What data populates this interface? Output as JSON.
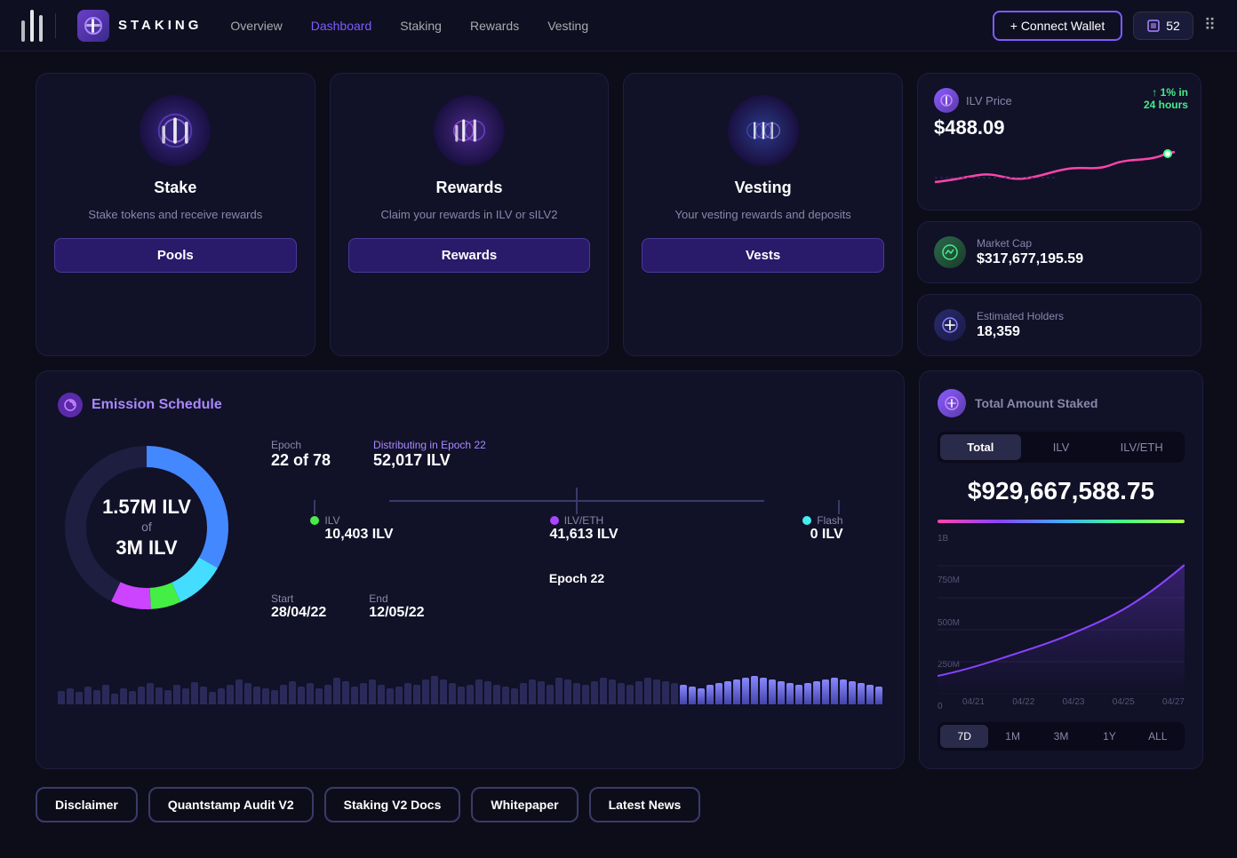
{
  "nav": {
    "logo_text": "STAKING",
    "links": [
      {
        "label": "Overview",
        "active": false
      },
      {
        "label": "Dashboard",
        "active": false
      },
      {
        "label": "Staking",
        "active": false
      },
      {
        "label": "Rewards",
        "active": false
      },
      {
        "label": "Vesting",
        "active": false
      }
    ],
    "connect_label": "+ Connect Wallet",
    "badge_value": "52"
  },
  "stake_card": {
    "title": "Stake",
    "description": "Stake tokens and receive rewards",
    "button_label": "Pools"
  },
  "rewards_card": {
    "title": "Rewards",
    "description": "Claim your rewards in ILV or sILV2",
    "button_label": "Rewards"
  },
  "vesting_card": {
    "title": "Vesting",
    "description": "Your vesting rewards and deposits",
    "button_label": "Vests"
  },
  "price_card": {
    "label": "ILV Price",
    "value": "$488.09",
    "change": "1% in",
    "change2": "24 hours",
    "change_positive": true
  },
  "market_cap": {
    "label": "Market Cap",
    "value": "$317,677,195.59"
  },
  "holders": {
    "label": "Estimated Holders",
    "value": "18,359"
  },
  "emission": {
    "title": "Emission Schedule",
    "donut_main": "1.57M ILV",
    "donut_of": "of",
    "donut_total": "3M ILV",
    "epoch_label": "Epoch",
    "epoch_value": "22 of 78",
    "distributing_label": "Distributing in Epoch 22",
    "distributing_value": "52,017 ILV",
    "ilv_label": "ILV",
    "ilv_value": "10,403 ILV",
    "ilveth_label": "ILV/ETH",
    "ilveth_value": "41,613 ILV",
    "flash_label": "Flash",
    "flash_value": "0 ILV",
    "epoch_num_label": "Epoch 22",
    "start_label": "Start",
    "start_value": "28/04/22",
    "end_label": "End",
    "end_value": "12/05/22"
  },
  "staking_total": {
    "title": "Total Amount Staked",
    "tabs": [
      "Total",
      "ILV",
      "ILV/ETH"
    ],
    "active_tab": "Total",
    "amount": "$929,667,588.75",
    "chart_labels_y": [
      "1B",
      "750M",
      "500M",
      "250M",
      "0"
    ],
    "chart_labels_x": [
      "04/21",
      "04/22",
      "04/23",
      "04/25",
      "04/27"
    ],
    "time_tabs": [
      "7D",
      "1M",
      "3M",
      "1Y",
      "ALL"
    ],
    "active_time": "7D"
  },
  "footer": {
    "links": [
      "Disclaimer",
      "Quantstamp Audit V2",
      "Staking V2 Docs",
      "Whitepaper",
      "Latest News"
    ]
  }
}
